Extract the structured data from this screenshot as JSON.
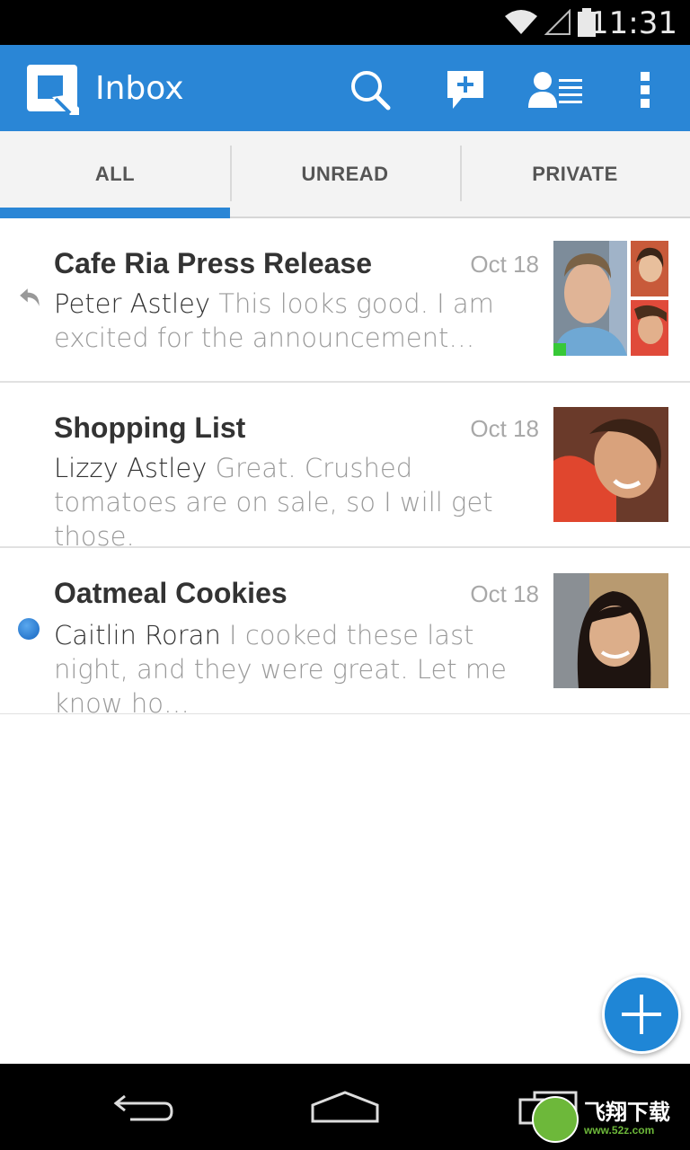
{
  "status_bar": {
    "time": "11:31",
    "icons": [
      "wifi-icon",
      "signal-icon",
      "battery-icon"
    ]
  },
  "action_bar": {
    "title": "Inbox",
    "icons": [
      "app-logo-icon",
      "search-icon",
      "compose-icon",
      "contacts-icon",
      "overflow-menu-icon"
    ],
    "color": "#2a86d6"
  },
  "tabs": [
    {
      "label": "ALL",
      "active": true
    },
    {
      "label": "UNREAD",
      "active": false
    },
    {
      "label": "PRIVATE",
      "active": false
    }
  ],
  "threads": [
    {
      "subject": "Cafe Ria Press Release",
      "date": "Oct 18",
      "sender": "Peter Astley",
      "preview": "This looks good. I am excited for the announcement…",
      "marker": "reply-icon",
      "avatars": [
        "peter-photo",
        "woman-photo-small",
        "woman-photo-small-2"
      ]
    },
    {
      "subject": "Shopping List",
      "date": "Oct 18",
      "sender": "Lizzy Astley",
      "preview": "Great. Crushed tomatoes are on sale, so I will get those.",
      "marker": "",
      "avatars": [
        "lizzy-photo"
      ]
    },
    {
      "subject": "Oatmeal Cookies",
      "date": "Oct 18",
      "sender": "Caitlin Roran",
      "preview": "I cooked these last night, and they were great. Let me know ho…",
      "marker": "unread-dot",
      "avatars": [
        "caitlin-photo"
      ]
    }
  ],
  "fab": {
    "icon": "plus-icon"
  },
  "nav_bar": {
    "icons": [
      "back-icon",
      "home-icon",
      "recents-icon"
    ]
  },
  "watermark": {
    "text": "飞翔下载",
    "sub": "www.52z.com"
  }
}
